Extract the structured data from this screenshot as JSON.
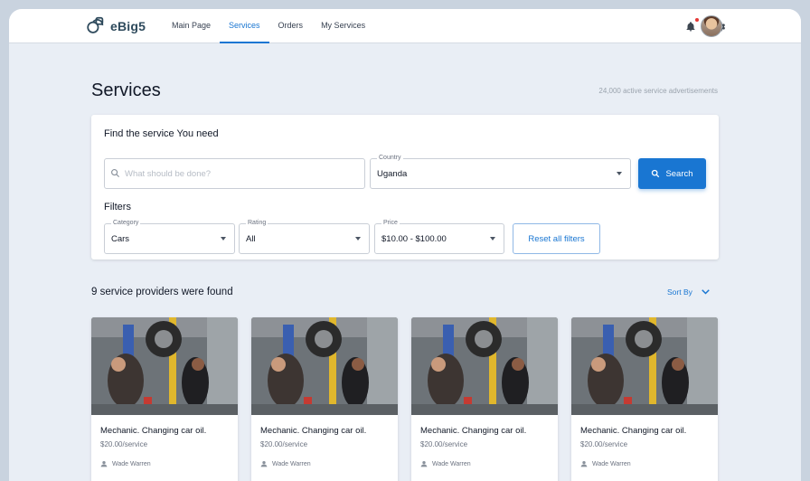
{
  "header": {
    "logo_text": "eBig5",
    "nav": [
      {
        "label": "Main Page"
      },
      {
        "label": "Services"
      },
      {
        "label": "Orders"
      },
      {
        "label": "My Services"
      }
    ],
    "active_nav": "Services",
    "icons": [
      "bell-icon",
      "gear-icon"
    ],
    "notification_dot_color": "#e53935",
    "accent_color": "#1976d2"
  },
  "page": {
    "title": "Services",
    "active_ads": "24,000 active service advertisements"
  },
  "search": {
    "heading": "Find the service You need",
    "input_placeholder": "What should be done?",
    "country_label": "Country",
    "country_value": "Uganda",
    "search_button": "Search"
  },
  "filters": {
    "heading": "Filters",
    "category_label": "Category",
    "category_value": "Cars",
    "rating_label": "Rating",
    "rating_value": "All",
    "price_label": "Price",
    "price_value": "$10.00 - $100.00",
    "reset_button": "Reset all filters"
  },
  "results": {
    "count_text": "9 service providers were found",
    "sort_label": "Sort By",
    "cards": [
      {
        "title": "Mechanic. Changing car oil.",
        "price": "$20.00/service",
        "author": "Wade Warren"
      },
      {
        "title": "Mechanic. Changing car oil.",
        "price": "$20.00/service",
        "author": "Wade Warren"
      },
      {
        "title": "Mechanic. Changing car oil.",
        "price": "$20.00/service",
        "author": "Wade Warren"
      },
      {
        "title": "Mechanic. Changing car oil.",
        "price": "$20.00/service",
        "author": "Wade Warren"
      }
    ]
  }
}
